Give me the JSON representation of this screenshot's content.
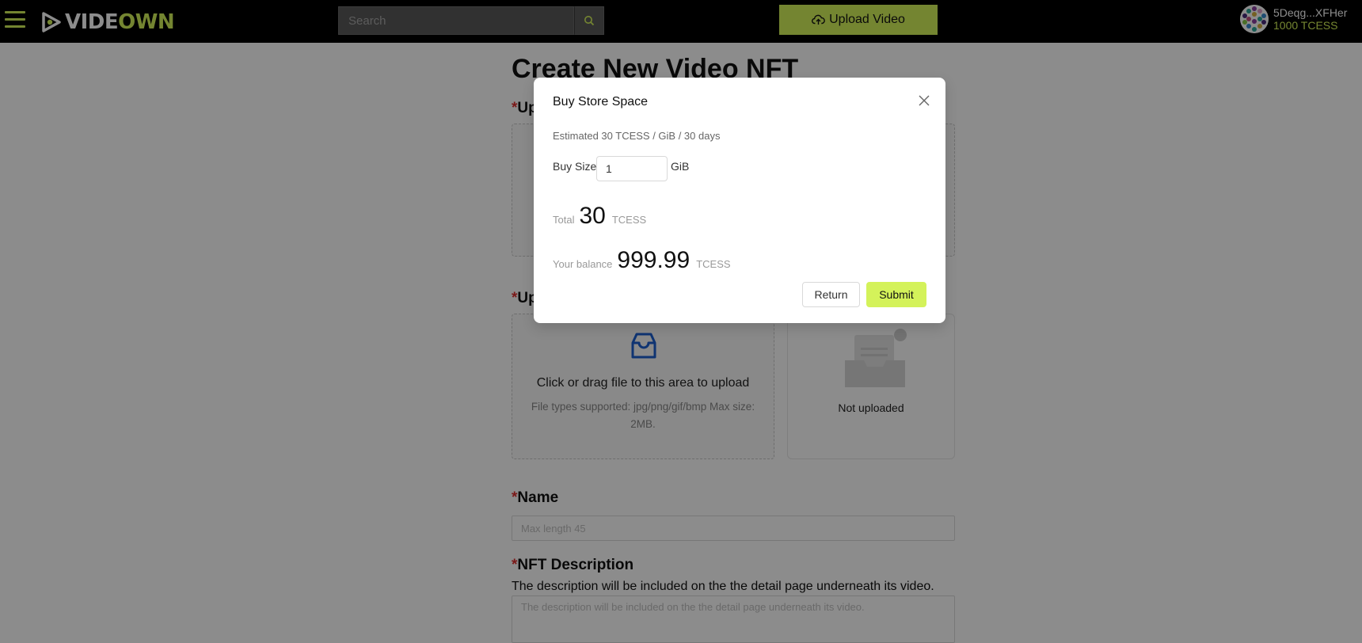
{
  "header": {
    "logo_part1": "VIDE",
    "logo_part2": "OWN",
    "search_placeholder": "Search",
    "upload_label": "Upload Video",
    "account_address": "5Deqg...XFHer",
    "account_balance": "1000 TCESS"
  },
  "page": {
    "title": "Create New Video NFT",
    "required_mark": "*",
    "upload_label_1": "Up",
    "upload_label_2": "Up",
    "cover_dropzone_title": "Click or drag file to this area to upload",
    "cover_dropzone_hint": "File types supported: jpg/png/gif/bmp Max size: 2MB.",
    "preview_status": "Not uploaded",
    "name_label": "Name",
    "name_placeholder": "Max length 45",
    "description_label": "NFT Description",
    "description_help": "The description will be included on the the detail page underneath its video.",
    "description_placeholder": "The description will be included on the the detail page underneath its video."
  },
  "modal": {
    "title": "Buy Store Space",
    "estimate": "Estimated 30 TCESS / GiB / 30 days",
    "buy_size_label": "Buy Size",
    "buy_size_value": "1",
    "buy_size_unit": "GiB",
    "total_label": "Total",
    "total_value": "30",
    "total_unit": "TCESS",
    "balance_label": "Your balance",
    "balance_value": "999.99",
    "balance_unit": "TCESS",
    "return_label": "Return",
    "submit_label": "Submit"
  },
  "colors": {
    "accent": "#d4f25a",
    "header_bg": "#000000",
    "required": "#e03030"
  }
}
